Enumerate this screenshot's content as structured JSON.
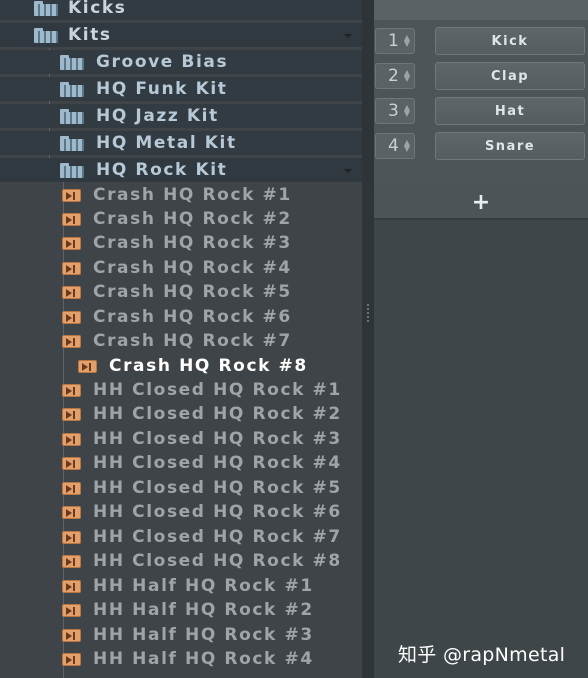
{
  "browser": {
    "folders": {
      "kicks": "Kicks",
      "kits": "Kits",
      "groove_bias": "Groove Bias",
      "hq_funk_kit": "HQ Funk Kit",
      "hq_jazz_kit": "HQ Jazz Kit",
      "hq_metal_kit": "HQ Metal Kit",
      "hq_rock_kit": "HQ Rock Kit"
    },
    "files": [
      "Crash HQ Rock #1",
      "Crash HQ Rock #2",
      "Crash HQ Rock #3",
      "Crash HQ Rock #4",
      "Crash HQ Rock #5",
      "Crash HQ Rock #6",
      "Crash HQ Rock #7",
      "Crash HQ Rock #8",
      "HH Closed HQ Rock #1",
      "HH Closed HQ Rock #2",
      "HH Closed HQ Rock #3",
      "HH Closed HQ Rock #4",
      "HH Closed HQ Rock #5",
      "HH Closed HQ Rock #6",
      "HH Closed HQ Rock #7",
      "HH Closed HQ Rock #8",
      "HH Half HQ Rock #1",
      "HH Half HQ Rock #2",
      "HH Half HQ Rock #3",
      "HH Half HQ Rock #4"
    ],
    "selected_file": "Crash HQ Rock #8"
  },
  "rack": {
    "channels": [
      {
        "num": "1",
        "name": "Kick"
      },
      {
        "num": "2",
        "name": "Clap"
      },
      {
        "num": "3",
        "name": "Hat"
      },
      {
        "num": "4",
        "name": "Snare"
      }
    ],
    "add_label": "+"
  },
  "watermark": "知乎 @rapNmetal",
  "colors": {
    "folder_text": "#b7c9d6",
    "file_text": "#9ea4a8",
    "selected_text": "#ffffff",
    "file_icon": "#e3a06b"
  }
}
